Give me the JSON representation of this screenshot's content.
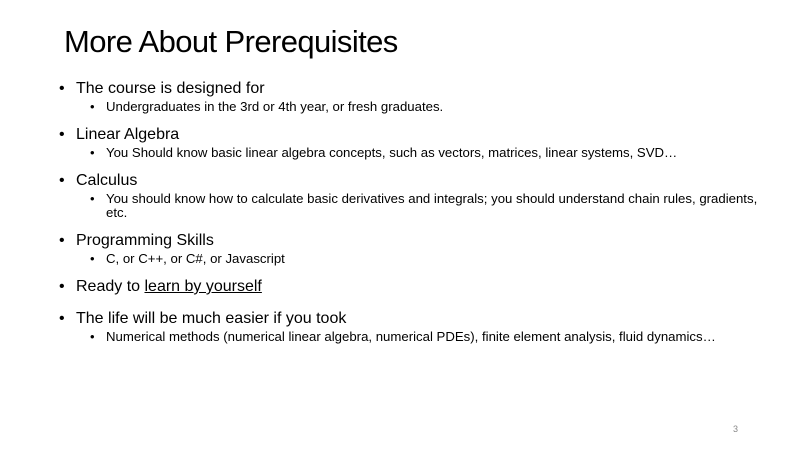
{
  "slide": {
    "title": "More About Prerequisites",
    "bullets": [
      {
        "text": "The course is designed for",
        "sub": [
          "Undergraduates in the 3rd or 4th year, or fresh graduates."
        ]
      },
      {
        "text": "Linear Algebra",
        "sub": [
          "You Should know basic linear algebra concepts, such as vectors, matrices, linear systems, SVD…"
        ]
      },
      {
        "text": "Calculus",
        "sub": [
          "You should know how to calculate basic derivatives and integrals; you should understand chain rules, gradients, etc."
        ]
      },
      {
        "text": "Programming Skills",
        "sub": [
          "C, or C++, or C#, or Javascript"
        ]
      },
      {
        "text_prefix": "Ready to ",
        "link_text": "learn by yourself"
      },
      {
        "text": "The life will be much easier if you took",
        "sub": [
          "Numerical methods (numerical linear algebra, numerical PDEs), finite element analysis, fluid dynamics…"
        ]
      }
    ],
    "page_number": "3"
  }
}
